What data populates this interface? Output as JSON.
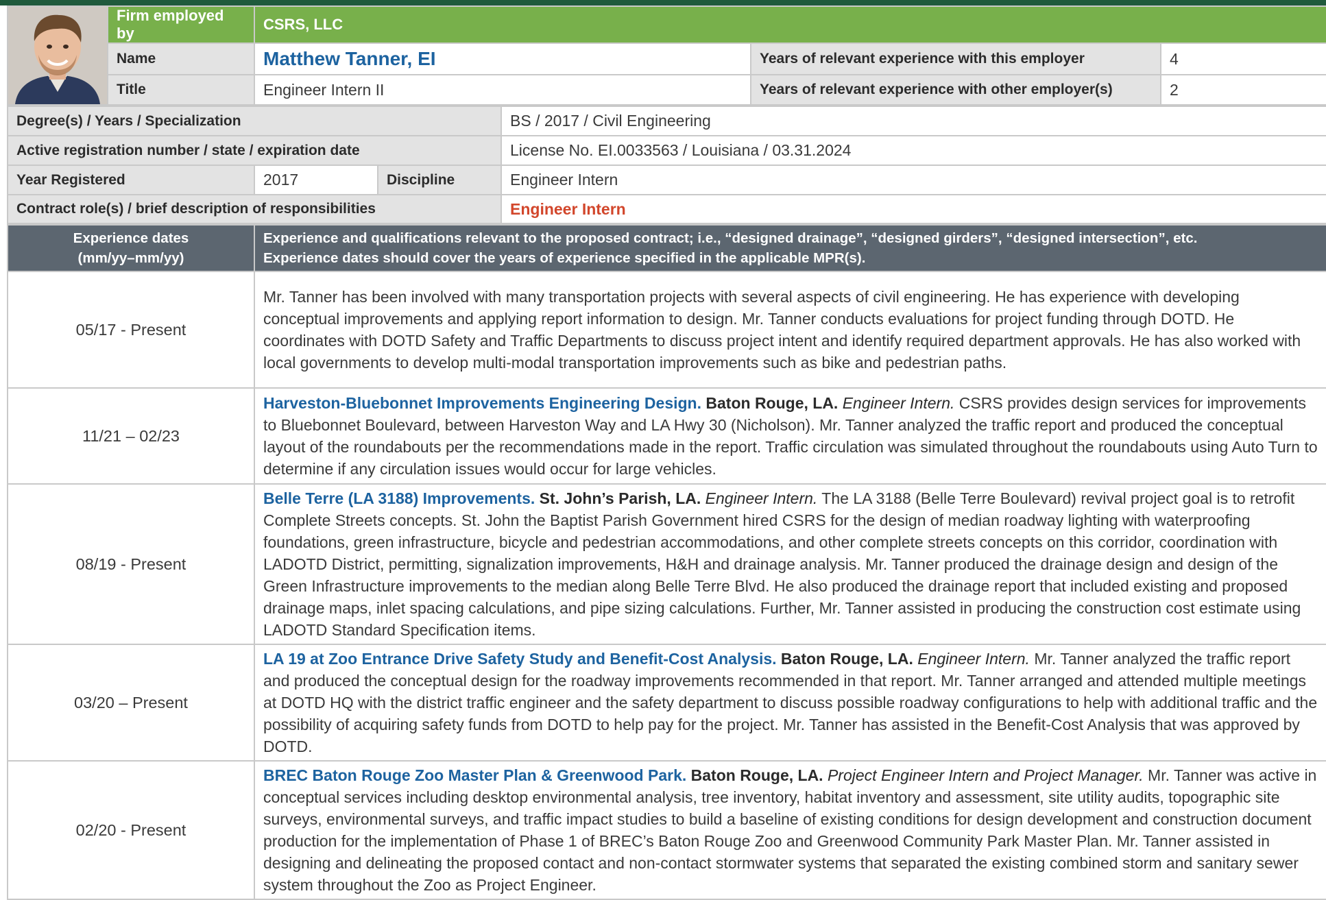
{
  "header": {
    "firm_label": "Firm employed by",
    "firm_value": "CSRS, LLC",
    "name_label": "Name",
    "name_value": "Matthew Tanner, EI",
    "title_label": "Title",
    "title_value": "Engineer Intern II",
    "years_this_label": "Years of relevant experience with this employer",
    "years_this_value": "4",
    "years_other_label": "Years of relevant experience with other employer(s)",
    "years_other_value": "2"
  },
  "details": {
    "degree_label": "Degree(s) / Years / Specialization",
    "degree_value": "BS / 2017 / Civil Engineering",
    "registration_label": "Active registration number / state / expiration date",
    "registration_value": "License No. EI.0033563 / Louisiana / 03.31.2024",
    "year_registered_label": "Year Registered",
    "year_registered_value": "2017",
    "discipline_label": "Discipline",
    "discipline_value": "Engineer Intern",
    "contract_role_label": "Contract role(s) / brief description of responsibilities",
    "contract_role_value": "Engineer Intern"
  },
  "experience_header": {
    "dates_line1": "Experience dates",
    "dates_line2": "(mm/yy–mm/yy)",
    "desc_line1": "Experience and qualifications relevant to the proposed contract; i.e., “designed drainage”, “designed girders”, “designed intersection”, etc.",
    "desc_line2": "Experience dates should cover the years of experience specified in the applicable MPR(s)."
  },
  "experience": [
    {
      "dates": "05/17 - Present",
      "title": "",
      "location": "",
      "role": "",
      "text": "Mr. Tanner has been involved with many transportation projects with several aspects of civil engineering. He has experience with developing conceptual improvements and applying report information to design. Mr. Tanner conducts evaluations for project funding through DOTD. He coordinates with DOTD Safety and Traffic Departments to discuss project intent and identify required department approvals.  He has also worked with local governments to develop multi-modal transportation improvements such as bike and pedestrian paths."
    },
    {
      "dates": "11/21 – 02/23",
      "title": "Harveston-Bluebonnet Improvements Engineering Design.",
      "location": "Baton Rouge, LA.",
      "role": "Engineer Intern.",
      "text": "CSRS provides design services for improvements to Bluebonnet Boulevard, between Harveston Way and LA Hwy 30 (Nicholson).  Mr. Tanner analyzed the traffic report and produced the conceptual layout of the roundabouts per the recommendations made in the report. Traffic circulation was simulated throughout the roundabouts using Auto Turn to determine if any circulation issues would occur for large vehicles."
    },
    {
      "dates": "08/19 - Present",
      "title": "Belle Terre (LA 3188) Improvements.",
      "location": "St. John’s Parish, LA.",
      "role": "Engineer Intern.",
      "text": "The LA 3188 (Belle Terre Boulevard) revival project goal is to retrofit Complete Streets concepts. St. John the Baptist Parish Government hired CSRS for the design of median roadway lighting with waterproofing foundations, green infrastructure, bicycle and pedestrian accommodations, and other complete streets concepts on this corridor, coordination with LADOTD District, permitting, signalization improvements, H&H and drainage analysis. Mr. Tanner produced the drainage design and design of the Green Infrastructure improvements to the median along Belle Terre Blvd. He also produced the drainage report that included existing and proposed drainage maps, inlet spacing calculations, and pipe sizing calculations. Further, Mr. Tanner assisted in producing the construction cost estimate using LADOTD Standard Specification items."
    },
    {
      "dates": "03/20 – Present",
      "title": "LA 19 at Zoo Entrance Drive Safety Study and Benefit-Cost Analysis.",
      "location": "Baton Rouge, LA.",
      "role": "Engineer Intern.",
      "text": "Mr. Tanner analyzed the traffic report and produced the conceptual design for the roadway improvements recommended in that report. Mr. Tanner arranged and attended multiple meetings at DOTD HQ with the district traffic engineer and the safety department to discuss possible roadway configurations to help with additional traffic and the possibility of acquiring safety funds from DOTD to help pay for the project. Mr. Tanner has assisted in the Benefit-Cost Analysis that was approved by DOTD."
    },
    {
      "dates": "02/20 - Present",
      "title": "BREC Baton Rouge Zoo Master Plan & Greenwood Park.",
      "location": "Baton Rouge, LA.",
      "role": "Project Engineer Intern and Project Manager.",
      "text": "Mr. Tanner was active in conceptual services including desktop environmental analysis, tree inventory, habitat inventory and assessment, site utility audits, topographic site surveys, environmental surveys, and traffic impact studies to build a baseline of existing conditions for design development and construction document production for the implementation of Phase 1 of BREC’s Baton Rouge Zoo and Greenwood Community Park Master Plan. Mr. Tanner assisted in designing and delineating the proposed contact and non-contact stormwater systems that separated the existing combined storm and sanitary sewer system throughout the Zoo as Project Engineer."
    }
  ]
}
